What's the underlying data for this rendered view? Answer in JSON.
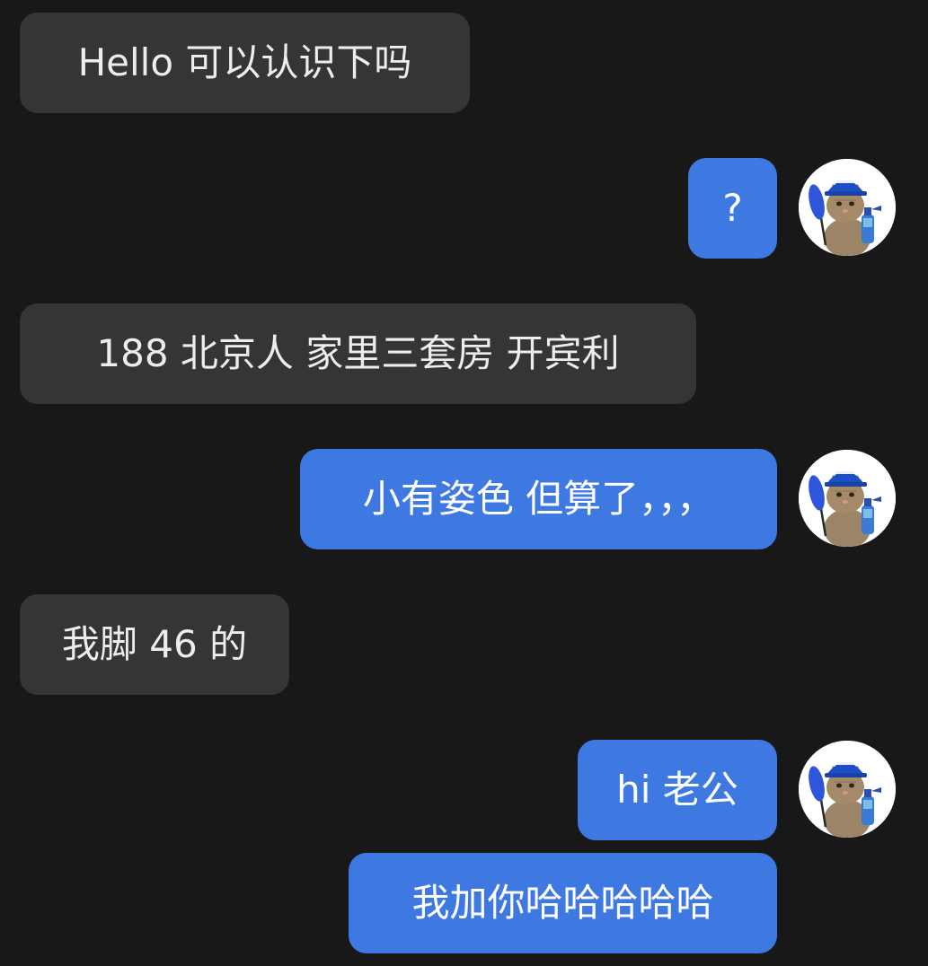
{
  "chat": {
    "messages": [
      {
        "direction": "incoming",
        "text": "Hello 可以认识下吗"
      },
      {
        "direction": "outgoing",
        "text": "?",
        "avatar": "cat-cleaner-avatar"
      },
      {
        "direction": "incoming",
        "text": "188 北京人 家里三套房 开宾利"
      },
      {
        "direction": "outgoing",
        "text": "小有姿色 但算了，，，",
        "avatar": "cat-cleaner-avatar"
      },
      {
        "direction": "incoming",
        "text": "我脚 46 的"
      },
      {
        "direction": "outgoing",
        "text": "hi 老公",
        "avatar": "cat-cleaner-avatar"
      },
      {
        "direction": "outgoing",
        "text": "我加你哈哈哈哈哈"
      }
    ]
  },
  "colors": {
    "background": "#181818",
    "incoming_bubble": "#353535",
    "outgoing_bubble": "#3e78e1",
    "text": "#ffffff"
  }
}
